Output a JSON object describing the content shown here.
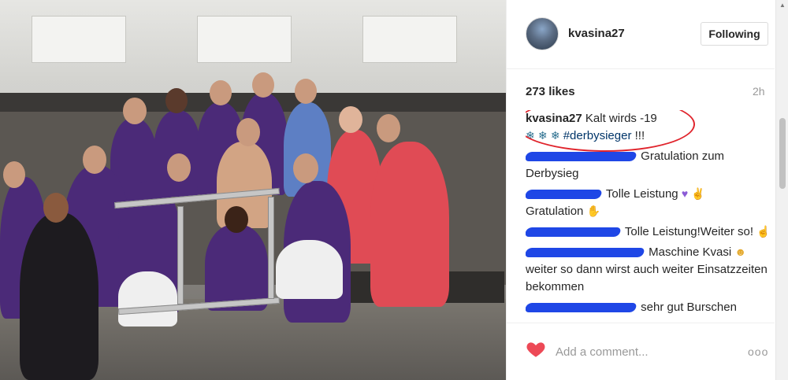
{
  "post": {
    "username": "kvasina27",
    "follow_label": "Following",
    "likes": "273 likes",
    "time": "2h",
    "caption": {
      "user": "kvasina27",
      "text": "Kalt wirds -19",
      "hashtag": "#derbysieger",
      "suffix": "!!!"
    },
    "comments": [
      {
        "text": "Gratulation zum Derbysieg"
      },
      {
        "text": "Tolle Leistung",
        "line2": "Gratulation"
      },
      {
        "text": "Tolle Leistung!Weiter so!"
      },
      {
        "text": "Maschine Kvasi",
        "line2": "weiter so dann wirst auch weiter Einsatzzeiten bekommen"
      },
      {
        "text": "sehr gut Burschen"
      }
    ],
    "add_comment_placeholder": "Add a comment...",
    "more_label": "ooo"
  },
  "colors": {
    "like_heart": "#ed4956",
    "caption_circle": "#e0242c",
    "redaction": "#1f47e6",
    "hashtag": "#003569"
  },
  "icons": {
    "like": "heart-icon",
    "more": "more-options-icon",
    "snowflake": "snowflake-icon"
  }
}
